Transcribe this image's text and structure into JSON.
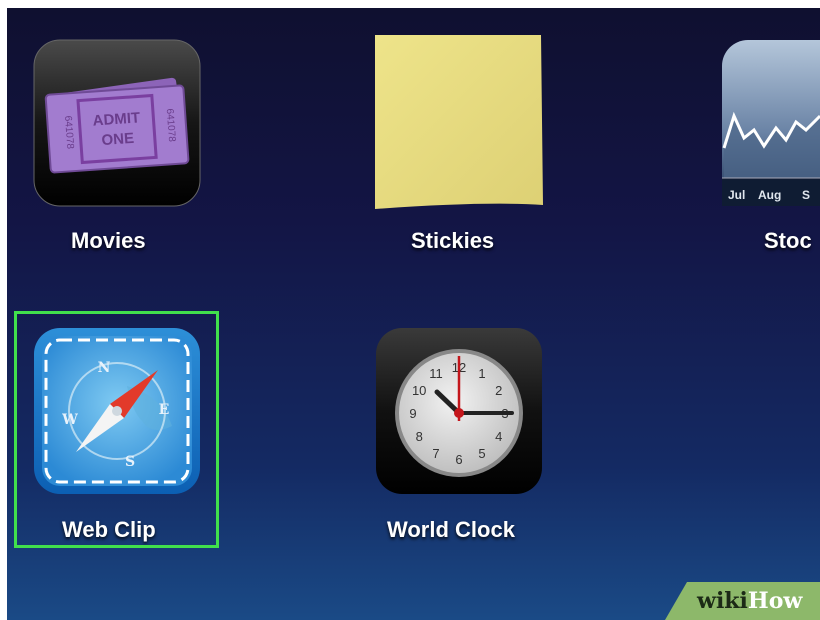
{
  "apps": [
    {
      "label": "Movies",
      "icon": "ticket-icon",
      "ticket_text": [
        "ADMIT",
        "ONE"
      ],
      "ticket_serial": "641078"
    },
    {
      "label": "Stickies",
      "icon": "sticky-note-icon"
    },
    {
      "label": "Stoc",
      "icon": "stock-chart-icon",
      "chart_ticks": [
        "Jul",
        "Aug",
        "S"
      ]
    },
    {
      "label": "Web Clip",
      "icon": "compass-icon",
      "compass_letters": [
        "N",
        "E",
        "S",
        "W"
      ],
      "selected": true
    },
    {
      "label": "World Clock",
      "icon": "clock-icon",
      "clock_numbers": [
        "12",
        "1",
        "2",
        "3",
        "4",
        "5",
        "6",
        "7",
        "8",
        "9",
        "10",
        "11"
      ]
    }
  ],
  "colors": {
    "selection": "#41e04c",
    "sticky": "#e8de82",
    "ticket": "#a27ccf"
  },
  "watermark": {
    "wiki": "wiki",
    "how": "How"
  }
}
